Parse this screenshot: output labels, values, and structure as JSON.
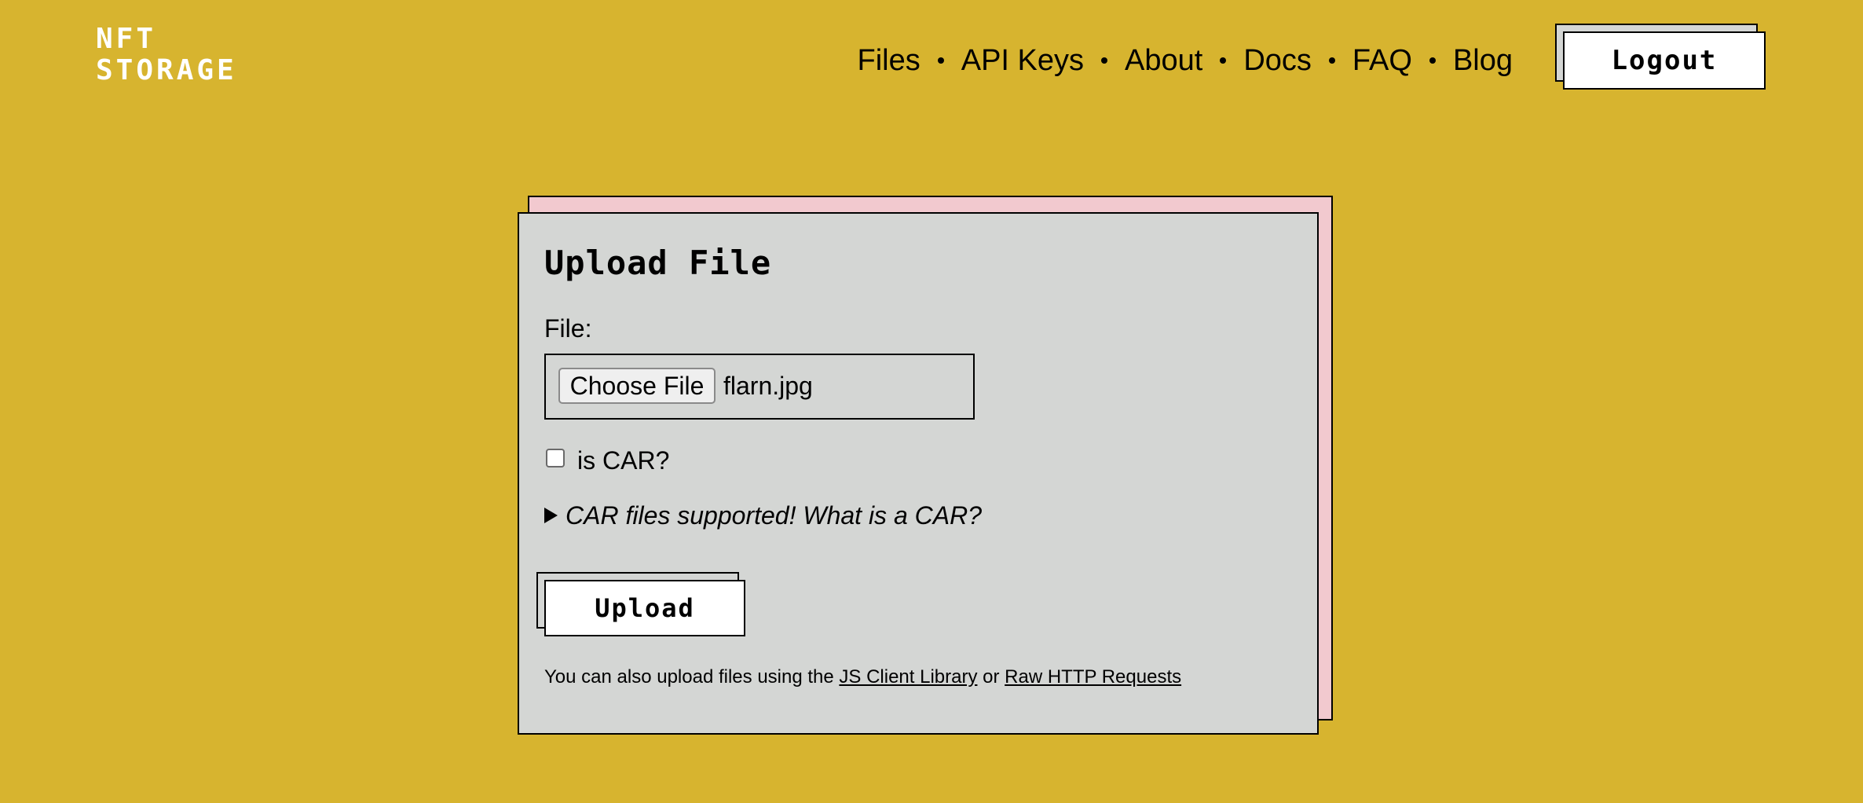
{
  "header": {
    "logo": {
      "line1": "NFT",
      "line2": "STORAGE"
    },
    "nav": [
      {
        "label": "Files"
      },
      {
        "label": "API Keys"
      },
      {
        "label": "About"
      },
      {
        "label": "Docs"
      },
      {
        "label": "FAQ"
      },
      {
        "label": "Blog"
      }
    ],
    "logout_label": "Logout"
  },
  "upload_form": {
    "title": "Upload File",
    "file_label": "File:",
    "choose_file_label": "Choose File",
    "selected_file": "flarn.jpg",
    "is_car_label": "is CAR?",
    "is_car_checked": false,
    "car_details_summary": "CAR files supported! What is a CAR?",
    "upload_label": "Upload",
    "footnote": {
      "prefix": "You can also upload files using the ",
      "link1": "JS Client Library",
      "middle": " or ",
      "link2": "Raw HTTP Requests"
    }
  },
  "colors": {
    "background": "#d7b42f",
    "card": "#d4d6d4",
    "card_back": "#f2c9cf",
    "button": "#ffffff",
    "logo": "#ffffff"
  }
}
